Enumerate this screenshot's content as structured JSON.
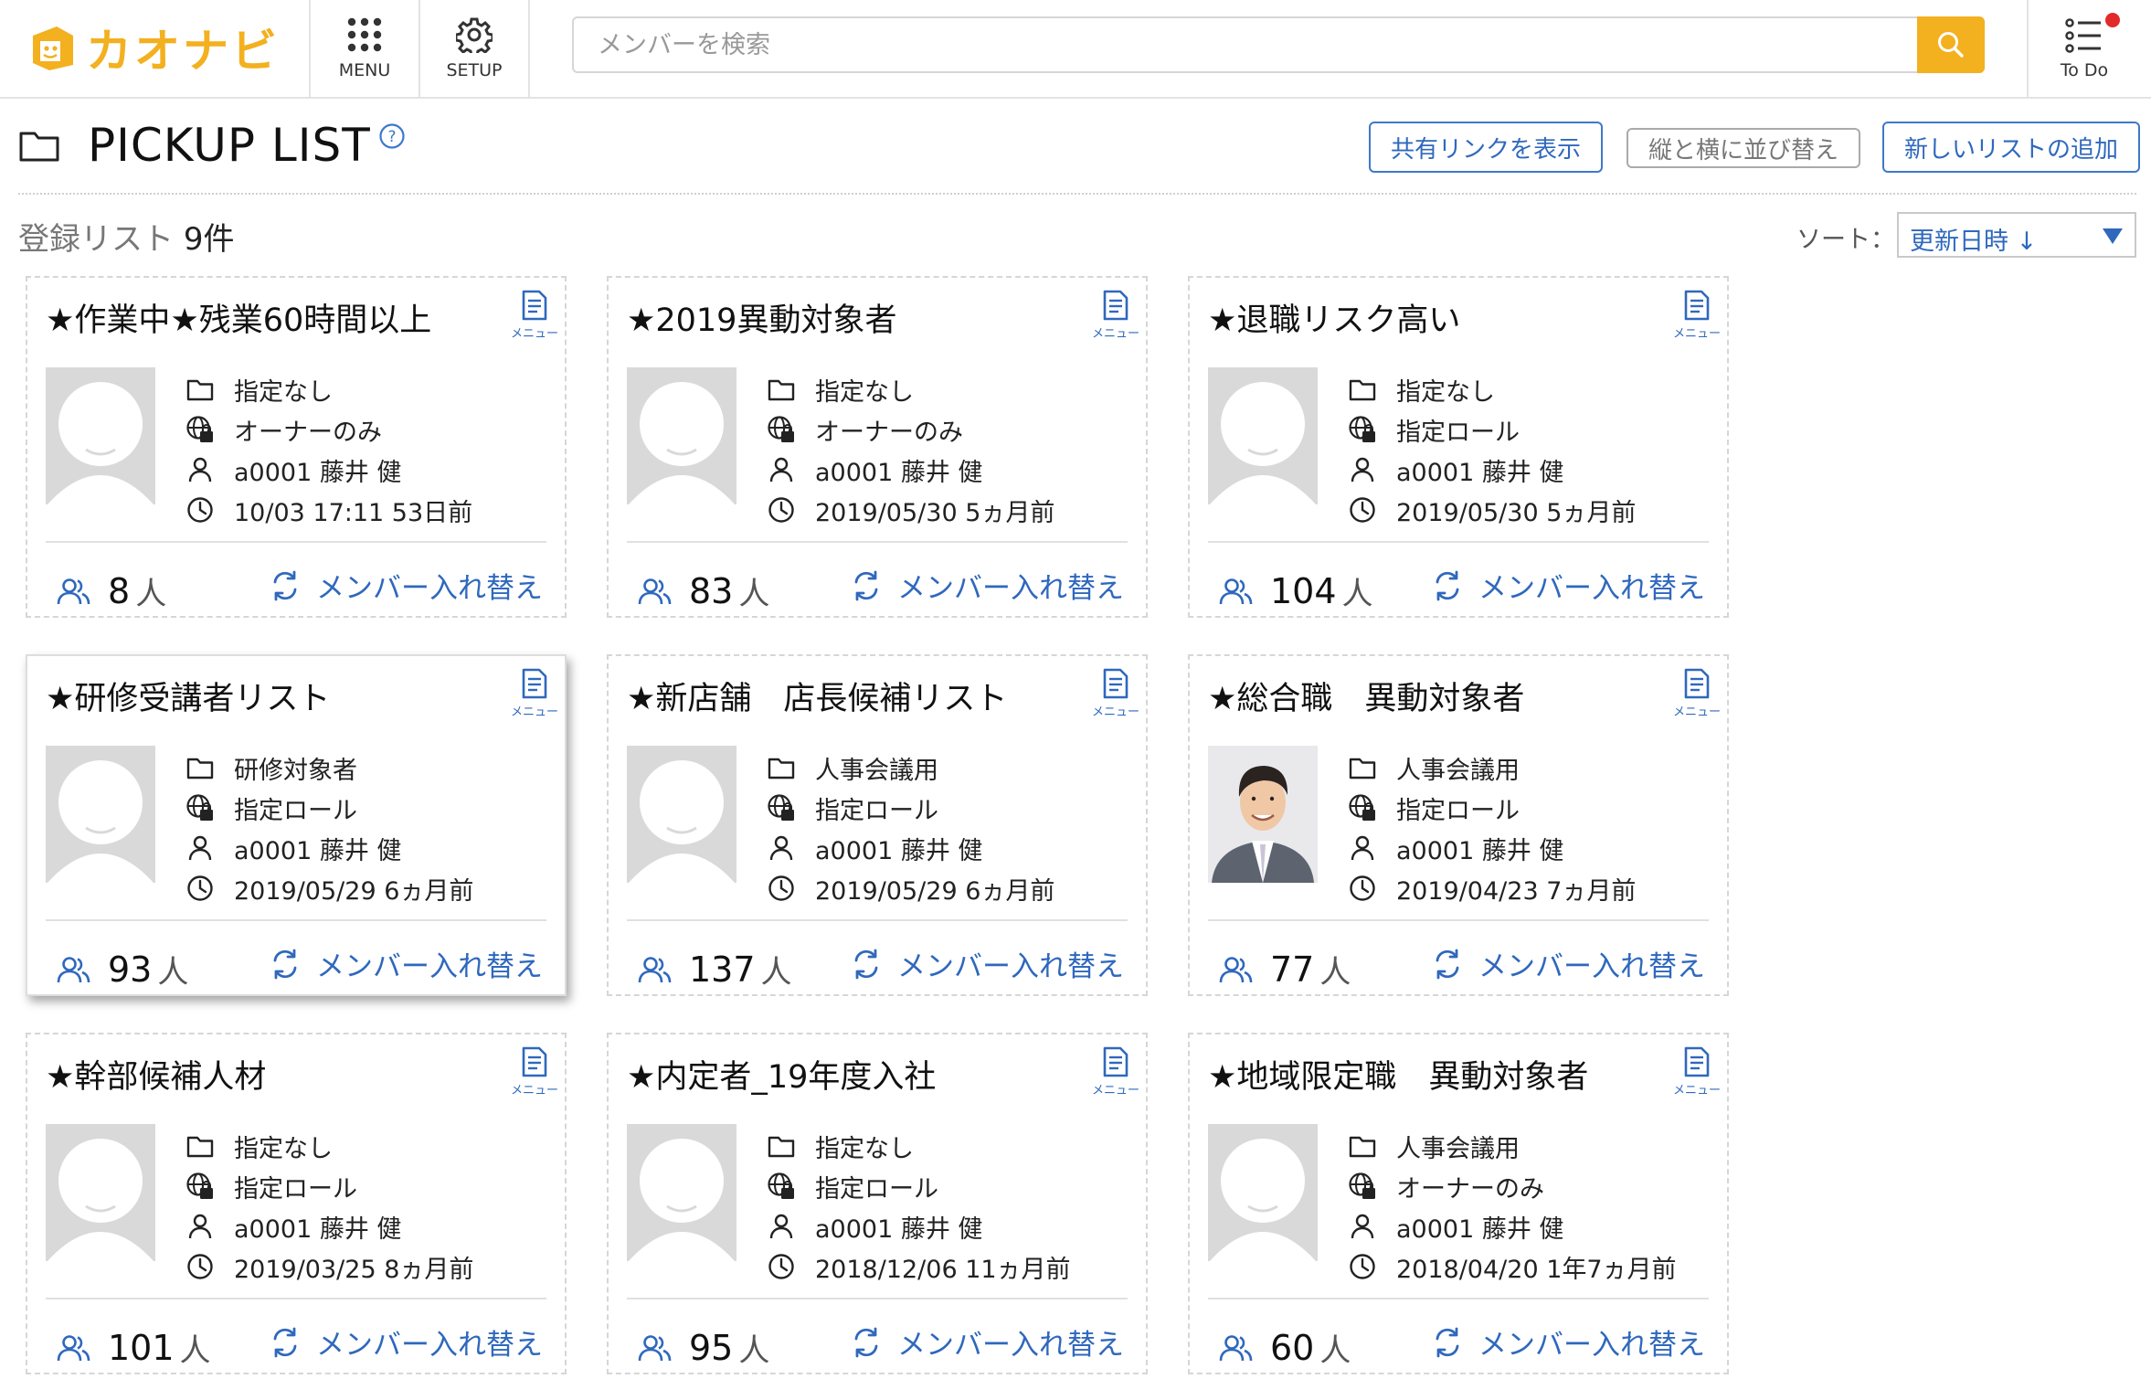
{
  "header": {
    "logo_text": "カオナビ",
    "menu_label": "MENU",
    "setup_label": "SETUP",
    "search_placeholder": "メンバーを検索",
    "todo_label": "To Do"
  },
  "page": {
    "title": "PICKUP LIST",
    "buttons": {
      "share": "共有リンクを表示",
      "swap_axes": "縦と横に並び替え",
      "add": "新しいリストの追加"
    },
    "count_label": "登録リスト",
    "count_value": "9件",
    "sort_label": "ソート：",
    "sort_value": "更新日時 ↓"
  },
  "card_common": {
    "menu_label": "メニュー",
    "count_unit": "人",
    "swap_label": "メンバー入れ替え"
  },
  "colors": {
    "brand": "#f3b01f",
    "accent": "#2f68bd",
    "notification": "#e22a2a"
  },
  "cards": [
    {
      "title": "★作業中★残業60時間以上",
      "folder": "指定なし",
      "share": "オーナーのみ",
      "owner": "a0001 藤井 健",
      "date": "10/03 17:11 53日前",
      "count": "8",
      "avatar": "placeholder"
    },
    {
      "title": "★2019異動対象者",
      "folder": "指定なし",
      "share": "オーナーのみ",
      "owner": "a0001 藤井 健",
      "date": "2019/05/30 5ヵ月前",
      "count": "83",
      "avatar": "placeholder"
    },
    {
      "title": "★退職リスク高い",
      "folder": "指定なし",
      "share": "指定ロール",
      "owner": "a0001 藤井 健",
      "date": "2019/05/30 5ヵ月前",
      "count": "104",
      "avatar": "placeholder"
    },
    {
      "title": "★研修受講者リスト",
      "folder": "研修対象者",
      "share": "指定ロール",
      "owner": "a0001 藤井 健",
      "date": "2019/05/29 6ヵ月前",
      "count": "93",
      "avatar": "placeholder"
    },
    {
      "title": "★新店舗　店長候補リスト",
      "folder": "人事会議用",
      "share": "指定ロール",
      "owner": "a0001 藤井 健",
      "date": "2019/05/29 6ヵ月前",
      "count": "137",
      "avatar": "placeholder"
    },
    {
      "title": "★総合職　異動対象者",
      "folder": "人事会議用",
      "share": "指定ロール",
      "owner": "a0001 藤井 健",
      "date": "2019/04/23 7ヵ月前",
      "count": "77",
      "avatar": "photo"
    },
    {
      "title": "★幹部候補人材",
      "folder": "指定なし",
      "share": "指定ロール",
      "owner": "a0001 藤井 健",
      "date": "2019/03/25 8ヵ月前",
      "count": "101",
      "avatar": "placeholder"
    },
    {
      "title": "★内定者_19年度入社",
      "folder": "指定なし",
      "share": "指定ロール",
      "owner": "a0001 藤井 健",
      "date": "2018/12/06 11ヵ月前",
      "count": "95",
      "avatar": "placeholder"
    },
    {
      "title": "★地域限定職　異動対象者",
      "folder": "人事会議用",
      "share": "オーナーのみ",
      "owner": "a0001 藤井 健",
      "date": "2018/04/20 1年7ヵ月前",
      "count": "60",
      "avatar": "placeholder"
    }
  ]
}
